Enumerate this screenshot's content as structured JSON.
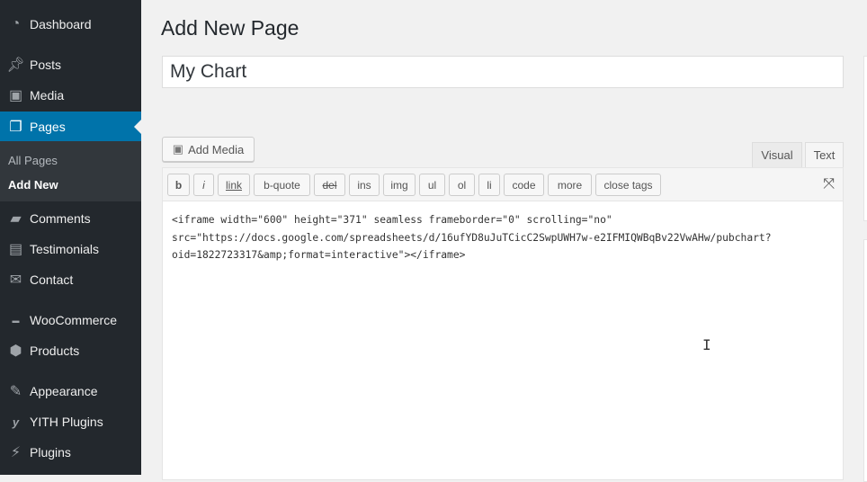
{
  "sidebar": {
    "items": [
      {
        "label": "Dashboard",
        "icon": "dashboard-icon"
      },
      {
        "label": "Posts",
        "icon": "pin-icon"
      },
      {
        "label": "Media",
        "icon": "media-icon"
      },
      {
        "label": "Pages",
        "icon": "pages-icon",
        "active": true
      },
      {
        "label": "Comments",
        "icon": "comment-icon"
      },
      {
        "label": "Testimonials",
        "icon": "testimonial-icon"
      },
      {
        "label": "Contact",
        "icon": "envelope-icon"
      },
      {
        "label": "WooCommerce",
        "icon": "woocommerce-icon"
      },
      {
        "label": "Products",
        "icon": "box-icon"
      },
      {
        "label": "Appearance",
        "icon": "brush-icon"
      },
      {
        "label": "YITH Plugins",
        "icon": "yith-icon"
      },
      {
        "label": "Plugins",
        "icon": "plug-icon"
      }
    ],
    "submenu": [
      {
        "label": "All Pages"
      },
      {
        "label": "Add New",
        "current": true
      }
    ]
  },
  "main": {
    "heading": "Add New Page",
    "title_value": "My Chart",
    "add_media": "Add Media",
    "tabs": [
      {
        "label": "Visual"
      },
      {
        "label": "Text",
        "active": true
      }
    ],
    "quicktags": [
      "b",
      "i",
      "link",
      "b-quote",
      "del",
      "ins",
      "img",
      "ul",
      "ol",
      "li",
      "code",
      "more",
      "close tags"
    ],
    "content": "<iframe width=\"600\" height=\"371\" seamless frameborder=\"0\" scrolling=\"no\"\nsrc=\"https://docs.google.com/spreadsheets/d/16ufYD8uJuTCicC2SwpUWH7w-e2IFMIQWBqBv22VwAHw/pubchart?\noid=1822723317&amp;format=interactive\"></iframe>"
  },
  "colors": {
    "sidebar": "#23282d",
    "active": "#0073aa",
    "submenu": "#32373c"
  }
}
